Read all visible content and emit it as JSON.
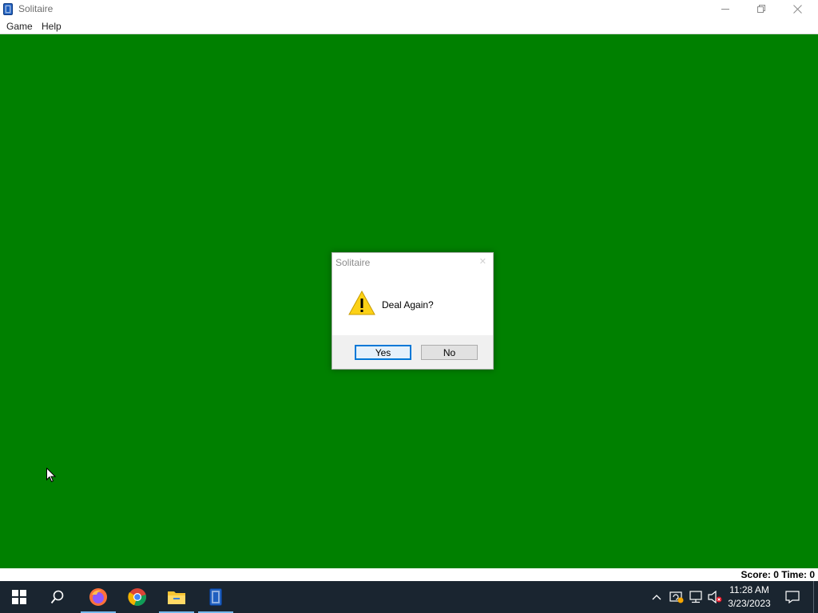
{
  "window": {
    "title": "Solitaire",
    "icon": "solitaire-card-icon"
  },
  "menu": {
    "items": [
      {
        "label": "Game"
      },
      {
        "label": "Help"
      }
    ]
  },
  "table": {
    "felt_color": "#008000"
  },
  "status": {
    "text": "Score: 0 Time: 0"
  },
  "dialog": {
    "title": "Solitaire",
    "icon": "warning-icon",
    "message": "Deal Again?",
    "yes_label": "Yes",
    "no_label": "No",
    "default_button": "Yes"
  },
  "taskbar": {
    "apps": [
      {
        "name": "Start",
        "icon": "windows-logo-icon"
      },
      {
        "name": "Search",
        "icon": "search-icon"
      },
      {
        "name": "Firefox",
        "icon": "firefox-icon",
        "active": true
      },
      {
        "name": "Chrome",
        "icon": "chrome-icon"
      },
      {
        "name": "File Explorer",
        "icon": "folder-icon",
        "active": true
      },
      {
        "name": "Solitaire",
        "icon": "solitaire-card-icon",
        "active": true
      }
    ],
    "tray_icons": [
      "chevron-up-icon",
      "shield-update-icon",
      "network-icon",
      "volume-muted-icon"
    ],
    "time": "11:28 AM",
    "date": "3/23/2023"
  }
}
